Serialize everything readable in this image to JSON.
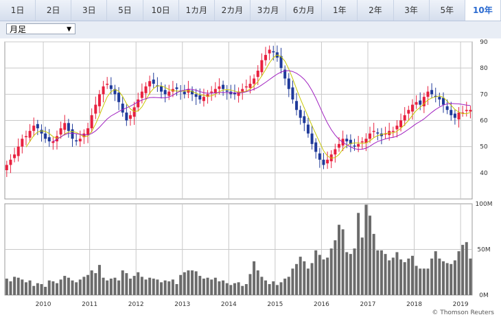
{
  "tabs": [
    {
      "label": "1日"
    },
    {
      "label": "2日"
    },
    {
      "label": "3日"
    },
    {
      "label": "5日"
    },
    {
      "label": "10日"
    },
    {
      "label": "1カ月"
    },
    {
      "label": "2カ月"
    },
    {
      "label": "3カ月"
    },
    {
      "label": "6カ月"
    },
    {
      "label": "1年"
    },
    {
      "label": "2年"
    },
    {
      "label": "3年"
    },
    {
      "label": "5年"
    },
    {
      "label": "10年"
    }
  ],
  "active_tab": 13,
  "period_select": {
    "value": "月足"
  },
  "credit": "© Thomson Reuters",
  "colors": {
    "up": "#e8213f",
    "down": "#1f3a9a",
    "ma_short": "#c8c800",
    "ma_long": "#a020c0",
    "volume": "#6b6b6b",
    "grid": "#c8c8c8"
  },
  "chart_data": {
    "type": "candlestick",
    "interval": "monthly",
    "price_axis": {
      "min": 30,
      "max": 90,
      "ticks": [
        40,
        50,
        60,
        70,
        80,
        90
      ]
    },
    "volume_axis": {
      "min": 0,
      "max": 100,
      "tick_labels": [
        {
          "v": 0,
          "label": "0M"
        },
        {
          "v": 50,
          "label": "50M"
        },
        {
          "v": 100,
          "label": "100M"
        }
      ]
    },
    "x_axis": {
      "start": 2009.17,
      "end": 2019.25,
      "year_labels": [
        "2010",
        "2011",
        "2012",
        "2013",
        "2014",
        "2015",
        "2016",
        "2017",
        "2018",
        "2019"
      ]
    },
    "close": [
      43,
      45,
      47,
      50,
      53,
      54,
      56,
      58,
      57,
      55,
      53,
      52,
      52,
      54,
      57,
      59,
      56,
      53,
      52,
      53,
      55,
      57,
      62,
      66,
      70,
      73,
      74,
      72,
      70,
      67,
      63,
      60,
      62,
      65,
      68,
      71,
      73,
      75,
      74,
      73,
      71,
      70,
      71,
      72,
      72,
      71,
      70,
      72,
      70,
      69,
      68,
      69,
      70,
      71,
      72,
      73,
      72,
      71,
      70,
      70,
      71,
      72,
      73,
      74,
      76,
      79,
      83,
      85,
      87,
      86,
      84,
      80,
      76,
      72,
      68,
      64,
      61,
      59,
      55,
      51,
      48,
      45,
      43,
      45,
      47,
      49,
      51,
      53,
      52,
      51,
      50,
      51,
      52,
      53,
      55,
      56,
      55,
      54,
      55,
      56,
      56,
      58,
      60,
      62,
      64,
      66,
      67,
      66,
      69,
      71,
      70,
      69,
      68,
      66,
      64,
      62,
      61,
      63,
      63,
      64,
      64
    ],
    "volume": [
      18,
      15,
      20,
      19,
      17,
      14,
      16,
      10,
      13,
      12,
      9,
      16,
      15,
      13,
      17,
      21,
      19,
      16,
      14,
      17,
      20,
      22,
      27,
      24,
      33,
      19,
      16,
      18,
      19,
      16,
      27,
      24,
      18,
      21,
      25,
      20,
      17,
      19,
      18,
      17,
      14,
      16,
      15,
      17,
      12,
      22,
      25,
      27,
      27,
      26,
      21,
      18,
      19,
      17,
      19,
      15,
      16,
      13,
      11,
      13,
      14,
      10,
      12,
      23,
      37,
      27,
      20,
      16,
      12,
      15,
      11,
      14,
      18,
      20,
      29,
      34,
      42,
      37,
      29,
      35,
      49,
      44,
      39,
      41,
      51,
      60,
      77,
      72,
      47,
      45,
      51,
      90,
      63,
      99,
      87,
      67,
      49,
      49,
      45,
      38,
      41,
      47,
      39,
      36,
      40,
      43,
      32,
      29,
      29,
      29,
      40,
      48,
      40,
      37,
      35,
      34,
      38,
      48,
      55,
      58,
      40,
      36,
      42,
      29,
      35
    ],
    "ma_short_start": 5,
    "ma_long_start": 12
  }
}
